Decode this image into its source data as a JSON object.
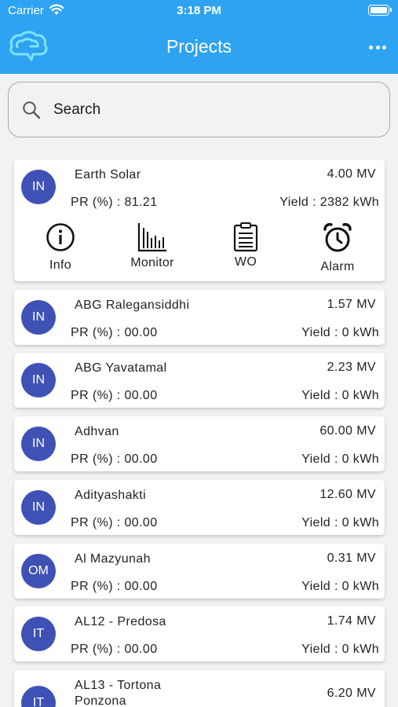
{
  "status_bar": {
    "carrier": "Carrier",
    "time": "3:18 PM"
  },
  "header": {
    "title": "Projects",
    "logo_icon": "cloud-chat-logo-icon",
    "menu_icon": "more-icon"
  },
  "search": {
    "placeholder": "Search",
    "value": ""
  },
  "colors": {
    "accent": "#2ea3f2",
    "avatar": "#3f51b5",
    "background": "#f2f2f4"
  },
  "projects": [
    {
      "code": "IN",
      "name": "Earth Solar",
      "capacity": "4.00 MV",
      "pr": "PR (%) : 81.21",
      "yield": "Yield : 2382 kWh",
      "actions": [
        {
          "label": "Info",
          "icon": "info-icon"
        },
        {
          "label": "Monitor",
          "icon": "bar-chart-icon"
        },
        {
          "label": "WO",
          "icon": "clipboard-icon"
        },
        {
          "label": "Alarm",
          "icon": "alarm-clock-icon"
        }
      ]
    },
    {
      "code": "IN",
      "name": "ABG Ralegansiddhi",
      "capacity": "1.57 MV",
      "pr": "PR (%) : 00.00",
      "yield": "Yield : 0 kWh"
    },
    {
      "code": "IN",
      "name": "ABG Yavatamal",
      "capacity": "2.23 MV",
      "pr": "PR (%) : 00.00",
      "yield": "Yield : 0 kWh"
    },
    {
      "code": "IN",
      "name": "Adhvan",
      "capacity": "60.00 MV",
      "pr": "PR (%) : 00.00",
      "yield": "Yield : 0 kWh"
    },
    {
      "code": "IN",
      "name": "Adityashakti",
      "capacity": "12.60 MV",
      "pr": "PR (%) : 00.00",
      "yield": "Yield : 0 kWh"
    },
    {
      "code": "OM",
      "name": "Al Mazyunah",
      "capacity": "0.31 MV",
      "pr": "PR (%) : 00.00",
      "yield": "Yield : 0 kWh"
    },
    {
      "code": "IT",
      "name": "AL12 - Predosa",
      "capacity": "1.74 MV",
      "pr": "PR (%) : 00.00",
      "yield": "Yield : 0 kWh"
    },
    {
      "code": "IT",
      "name": "AL13 - Tortona Ponzona",
      "capacity": "6.20 MV"
    }
  ]
}
